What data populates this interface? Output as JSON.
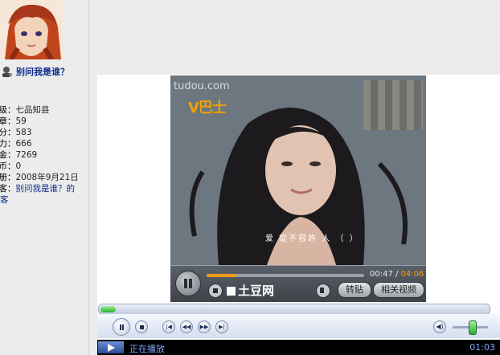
{
  "user": {
    "name": "别问我是谁？"
  },
  "stats": [
    {
      "key": "级",
      "value": "七品知县"
    },
    {
      "key": "章",
      "value": "59"
    },
    {
      "key": "分",
      "value": "583"
    },
    {
      "key": "力",
      "value": "666"
    },
    {
      "key": "金",
      "value": "7269"
    },
    {
      "key": "币",
      "value": "0"
    },
    {
      "key": "册",
      "value": "2008年9月21日"
    }
  ],
  "blog": {
    "key": "客",
    "link": "别问我是谁？的",
    "link_wrap": "客"
  },
  "video": {
    "watermark": "tudou.com",
    "channel_logo": "V巴士",
    "subtitle": "爱 從不容許 人 （ ）",
    "current_time": "00:47",
    "total_time": "04:06",
    "progress": 0.19,
    "brand": "土豆网",
    "repost_label": "转贴",
    "related_label": "相关视频"
  },
  "player": {
    "seek_progress": 0.04,
    "volume": 0.45,
    "status_text": "正在播放",
    "status_time": "01:03"
  }
}
